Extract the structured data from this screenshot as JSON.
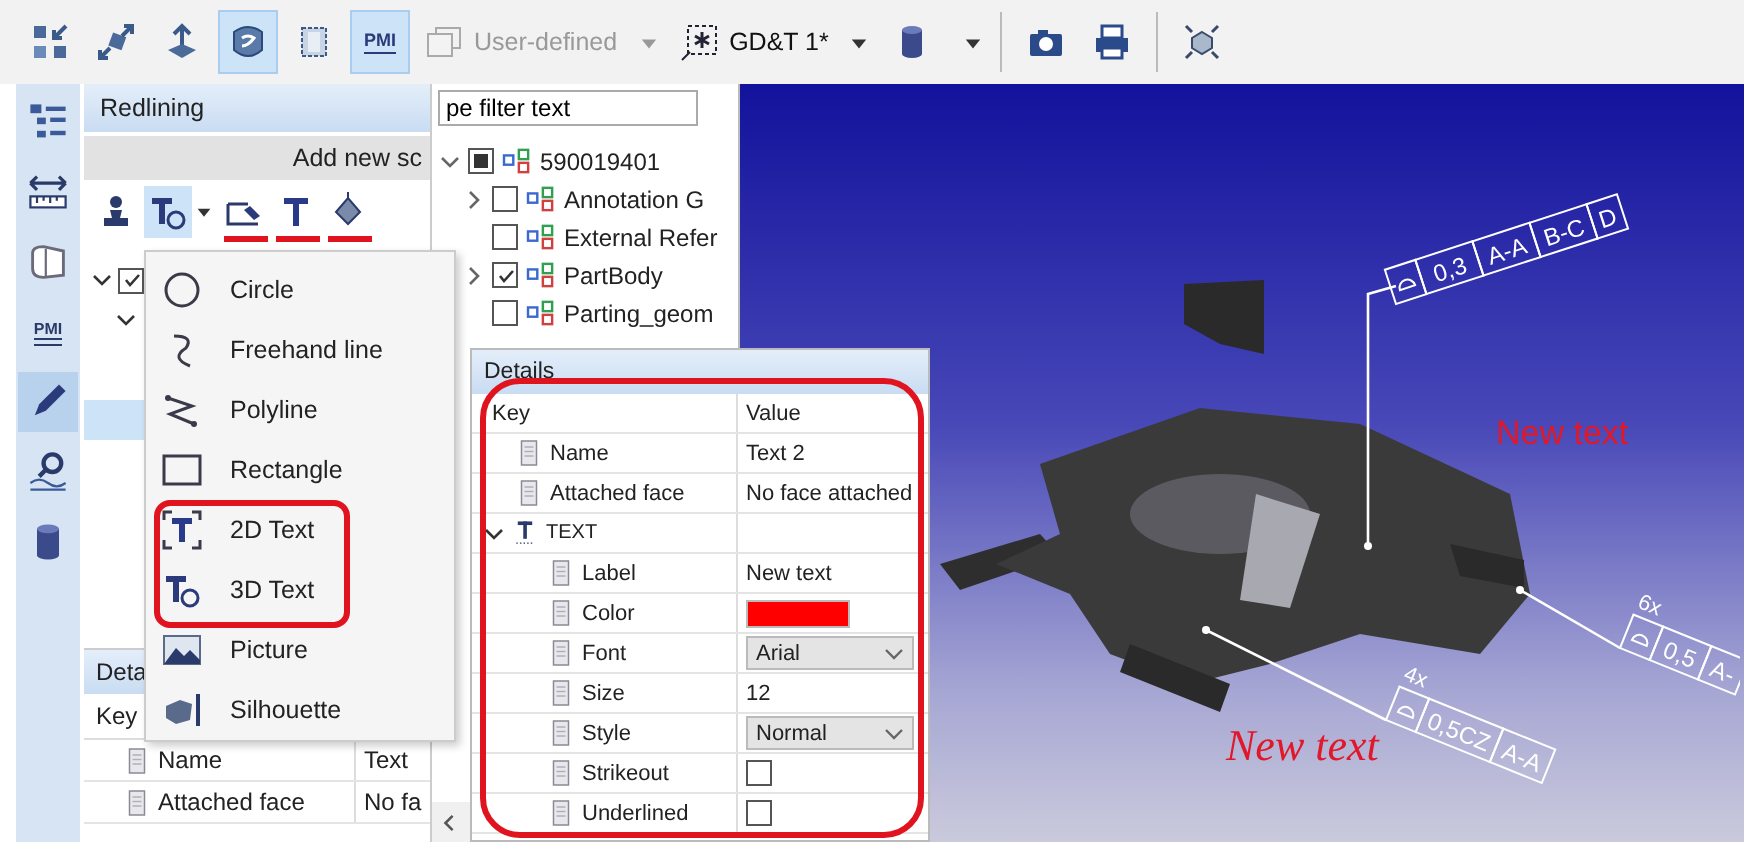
{
  "toolbar": {
    "buttons": [
      {
        "kind": "explode",
        "selected": false
      },
      {
        "kind": "move",
        "selected": false
      },
      {
        "kind": "axis",
        "selected": false
      },
      {
        "kind": "body",
        "selected": true
      },
      {
        "kind": "box",
        "selected": false
      },
      {
        "kind": "pmi",
        "label": "PMI",
        "selected": true
      }
    ],
    "view_dropdown": {
      "label": "User-defined",
      "disabled": true
    },
    "gdt_dropdown": {
      "label": "GD&T 1*"
    },
    "tools": [
      {
        "kind": "cylinder",
        "dropdown": true
      },
      {
        "kind": "camera"
      },
      {
        "kind": "printer"
      },
      {
        "kind": "cube"
      }
    ]
  },
  "rail": [
    {
      "kind": "tree",
      "selected": false
    },
    {
      "kind": "measure",
      "selected": false
    },
    {
      "kind": "section",
      "selected": false
    },
    {
      "kind": "pmi",
      "label": "PMI",
      "selected": false
    },
    {
      "kind": "pencil",
      "selected": true
    },
    {
      "kind": "search",
      "selected": false
    },
    {
      "kind": "cylinder",
      "selected": false
    }
  ],
  "redlining": {
    "title": "Redlining",
    "add_button": "Add new sc",
    "tools": [
      {
        "kind": "stamp",
        "selected": false
      },
      {
        "kind": "text3d",
        "selected": true,
        "dropdown": true
      },
      {
        "kind": "edit",
        "selected": false,
        "marked": true
      },
      {
        "kind": "text",
        "selected": false,
        "marked": true
      },
      {
        "kind": "fill",
        "selected": false,
        "marked": true
      }
    ],
    "tree": [
      {
        "checked": true,
        "expanded": true,
        "selected": false
      },
      {
        "expanded": true,
        "selected": false
      },
      {
        "selected": true
      }
    ],
    "details": {
      "title": "Deta",
      "columns": [
        "Key"
      ],
      "rows": [
        {
          "key": "Name",
          "value": "Text"
        },
        {
          "key": "Attached face",
          "value": "No fa"
        }
      ]
    }
  },
  "tree_panel": {
    "filter": {
      "value": "pe filter text"
    },
    "items": [
      {
        "label": "590019401",
        "expanded": true,
        "checked": false,
        "mixed": true,
        "children": [
          {
            "label": "Annotation G",
            "expanded": false,
            "checked": false
          },
          {
            "label": "External Refer",
            "checked": false
          },
          {
            "label": "PartBody",
            "expanded": false,
            "checked": true
          },
          {
            "label": "Parting_geom",
            "checked": false
          }
        ]
      }
    ]
  },
  "menu": {
    "items": [
      {
        "label": "Circle",
        "kind": "circle",
        "highlighted": false
      },
      {
        "label": "Freehand line",
        "kind": "freehand",
        "highlighted": false
      },
      {
        "label": "Polyline",
        "kind": "polyline",
        "highlighted": false
      },
      {
        "label": "Rectangle",
        "kind": "rectangle",
        "highlighted": false
      },
      {
        "label": "2D Text",
        "kind": "text2d",
        "highlighted": true
      },
      {
        "label": "3D Text",
        "kind": "text3d",
        "highlighted": true
      },
      {
        "label": "Picture",
        "kind": "picture",
        "highlighted": false
      },
      {
        "label": "Silhouette",
        "kind": "silhouette",
        "highlighted": false
      }
    ]
  },
  "details": {
    "title": "Details",
    "highlighted": true,
    "columns": [
      "Key",
      "Value"
    ],
    "rows": [
      {
        "key": "Name",
        "kind": "text",
        "value": "Text 2"
      },
      {
        "key": "Attached face",
        "kind": "text",
        "value": "No face attached"
      },
      {
        "key": "TEXT",
        "kind": "group",
        "expanded": true,
        "children": [
          {
            "key": "Label",
            "kind": "text",
            "value": "New text"
          },
          {
            "key": "Color",
            "kind": "color",
            "color": "#ff0000"
          },
          {
            "key": "Font",
            "kind": "dropdown",
            "value": "Arial"
          },
          {
            "key": "Size",
            "kind": "text",
            "value": "12"
          },
          {
            "key": "Style",
            "kind": "dropdown",
            "value": "Normal"
          },
          {
            "key": "Strikeout",
            "kind": "checkbox",
            "checked": false
          },
          {
            "key": "Underlined",
            "kind": "checkbox",
            "checked": false
          }
        ]
      }
    ]
  },
  "viewport": {
    "frames": [
      {
        "cells": [
          "0,3",
          "A-A",
          "B-C",
          "D"
        ]
      },
      {
        "count": "6x",
        "cells": [
          "0,5",
          "A-"
        ]
      },
      {
        "count": "4x",
        "cells": [
          "0,5CZ",
          "A-A"
        ]
      }
    ],
    "notes": [
      {
        "text": "New text",
        "kind": "sans"
      },
      {
        "text": "New text",
        "kind": "serif-italic"
      }
    ]
  }
}
